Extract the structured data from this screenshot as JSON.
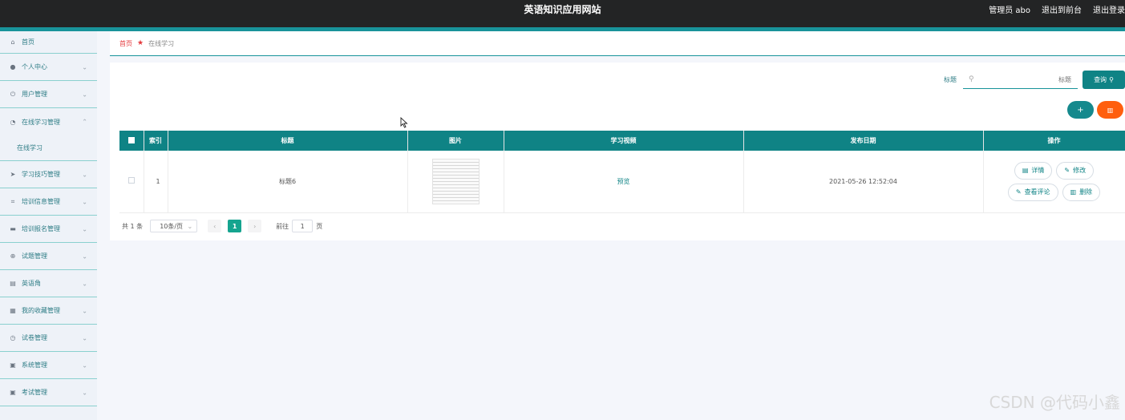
{
  "header": {
    "site_title": "英语知识应用网站",
    "admin_label": "管理员 abo",
    "exit_front": "退出到前台",
    "logout": "退出登录"
  },
  "sidebar": {
    "items": [
      {
        "label": "首页",
        "icon": "home-icon",
        "glyph": "⌂"
      },
      {
        "label": "个人中心",
        "icon": "user-icon",
        "glyph": "●"
      },
      {
        "label": "用户管理",
        "icon": "power-icon",
        "glyph": "⏻"
      },
      {
        "label": "在线学习管理",
        "icon": "dashboard-icon",
        "glyph": "◔",
        "expanded": true,
        "sub": "在线学习"
      },
      {
        "label": "学习技巧管理",
        "icon": "send-icon",
        "glyph": "➤"
      },
      {
        "label": "培训信息管理",
        "icon": "crop-icon",
        "glyph": "⌗"
      },
      {
        "label": "培训报名管理",
        "icon": "chat-icon",
        "glyph": "▬"
      },
      {
        "label": "试题管理",
        "icon": "globe-icon",
        "glyph": "⊕"
      },
      {
        "label": "英语角",
        "icon": "briefcase-icon",
        "glyph": "▤"
      },
      {
        "label": "我的收藏管理",
        "icon": "stack-icon",
        "glyph": "▦"
      },
      {
        "label": "试卷管理",
        "icon": "clock-icon",
        "glyph": "◷"
      },
      {
        "label": "系统管理",
        "icon": "clipboard-icon",
        "glyph": "▣"
      },
      {
        "label": "考试管理",
        "icon": "clipboard-check-icon",
        "glyph": "▣"
      }
    ]
  },
  "breadcrumb": {
    "home": "首页",
    "current": "在线学习"
  },
  "search": {
    "label": "标题",
    "placeholder": "标题",
    "button": "查询"
  },
  "toolbar": {
    "add": "+",
    "delete": "🗑"
  },
  "table": {
    "columns": [
      "",
      "索引",
      "标题",
      "图片",
      "学习视频",
      "发布日期",
      "操作"
    ],
    "rows": [
      {
        "index": "1",
        "title": "标题6",
        "video": "预览",
        "date": "2021-05-26 12:52:04",
        "actions": [
          "详情",
          "修改",
          "查看评论",
          "删除"
        ]
      }
    ]
  },
  "pagination": {
    "total": "共 1 条",
    "page_size": "10条/页",
    "current": "1",
    "goto_prefix": "前往",
    "goto_value": "1",
    "goto_suffix": "页"
  },
  "watermark": "CSDN @代码小鑫",
  "colors": {
    "primary": "#0f8385",
    "danger": "#ff5f0e",
    "topbar": "#232425",
    "link_red": "#e4393c"
  }
}
